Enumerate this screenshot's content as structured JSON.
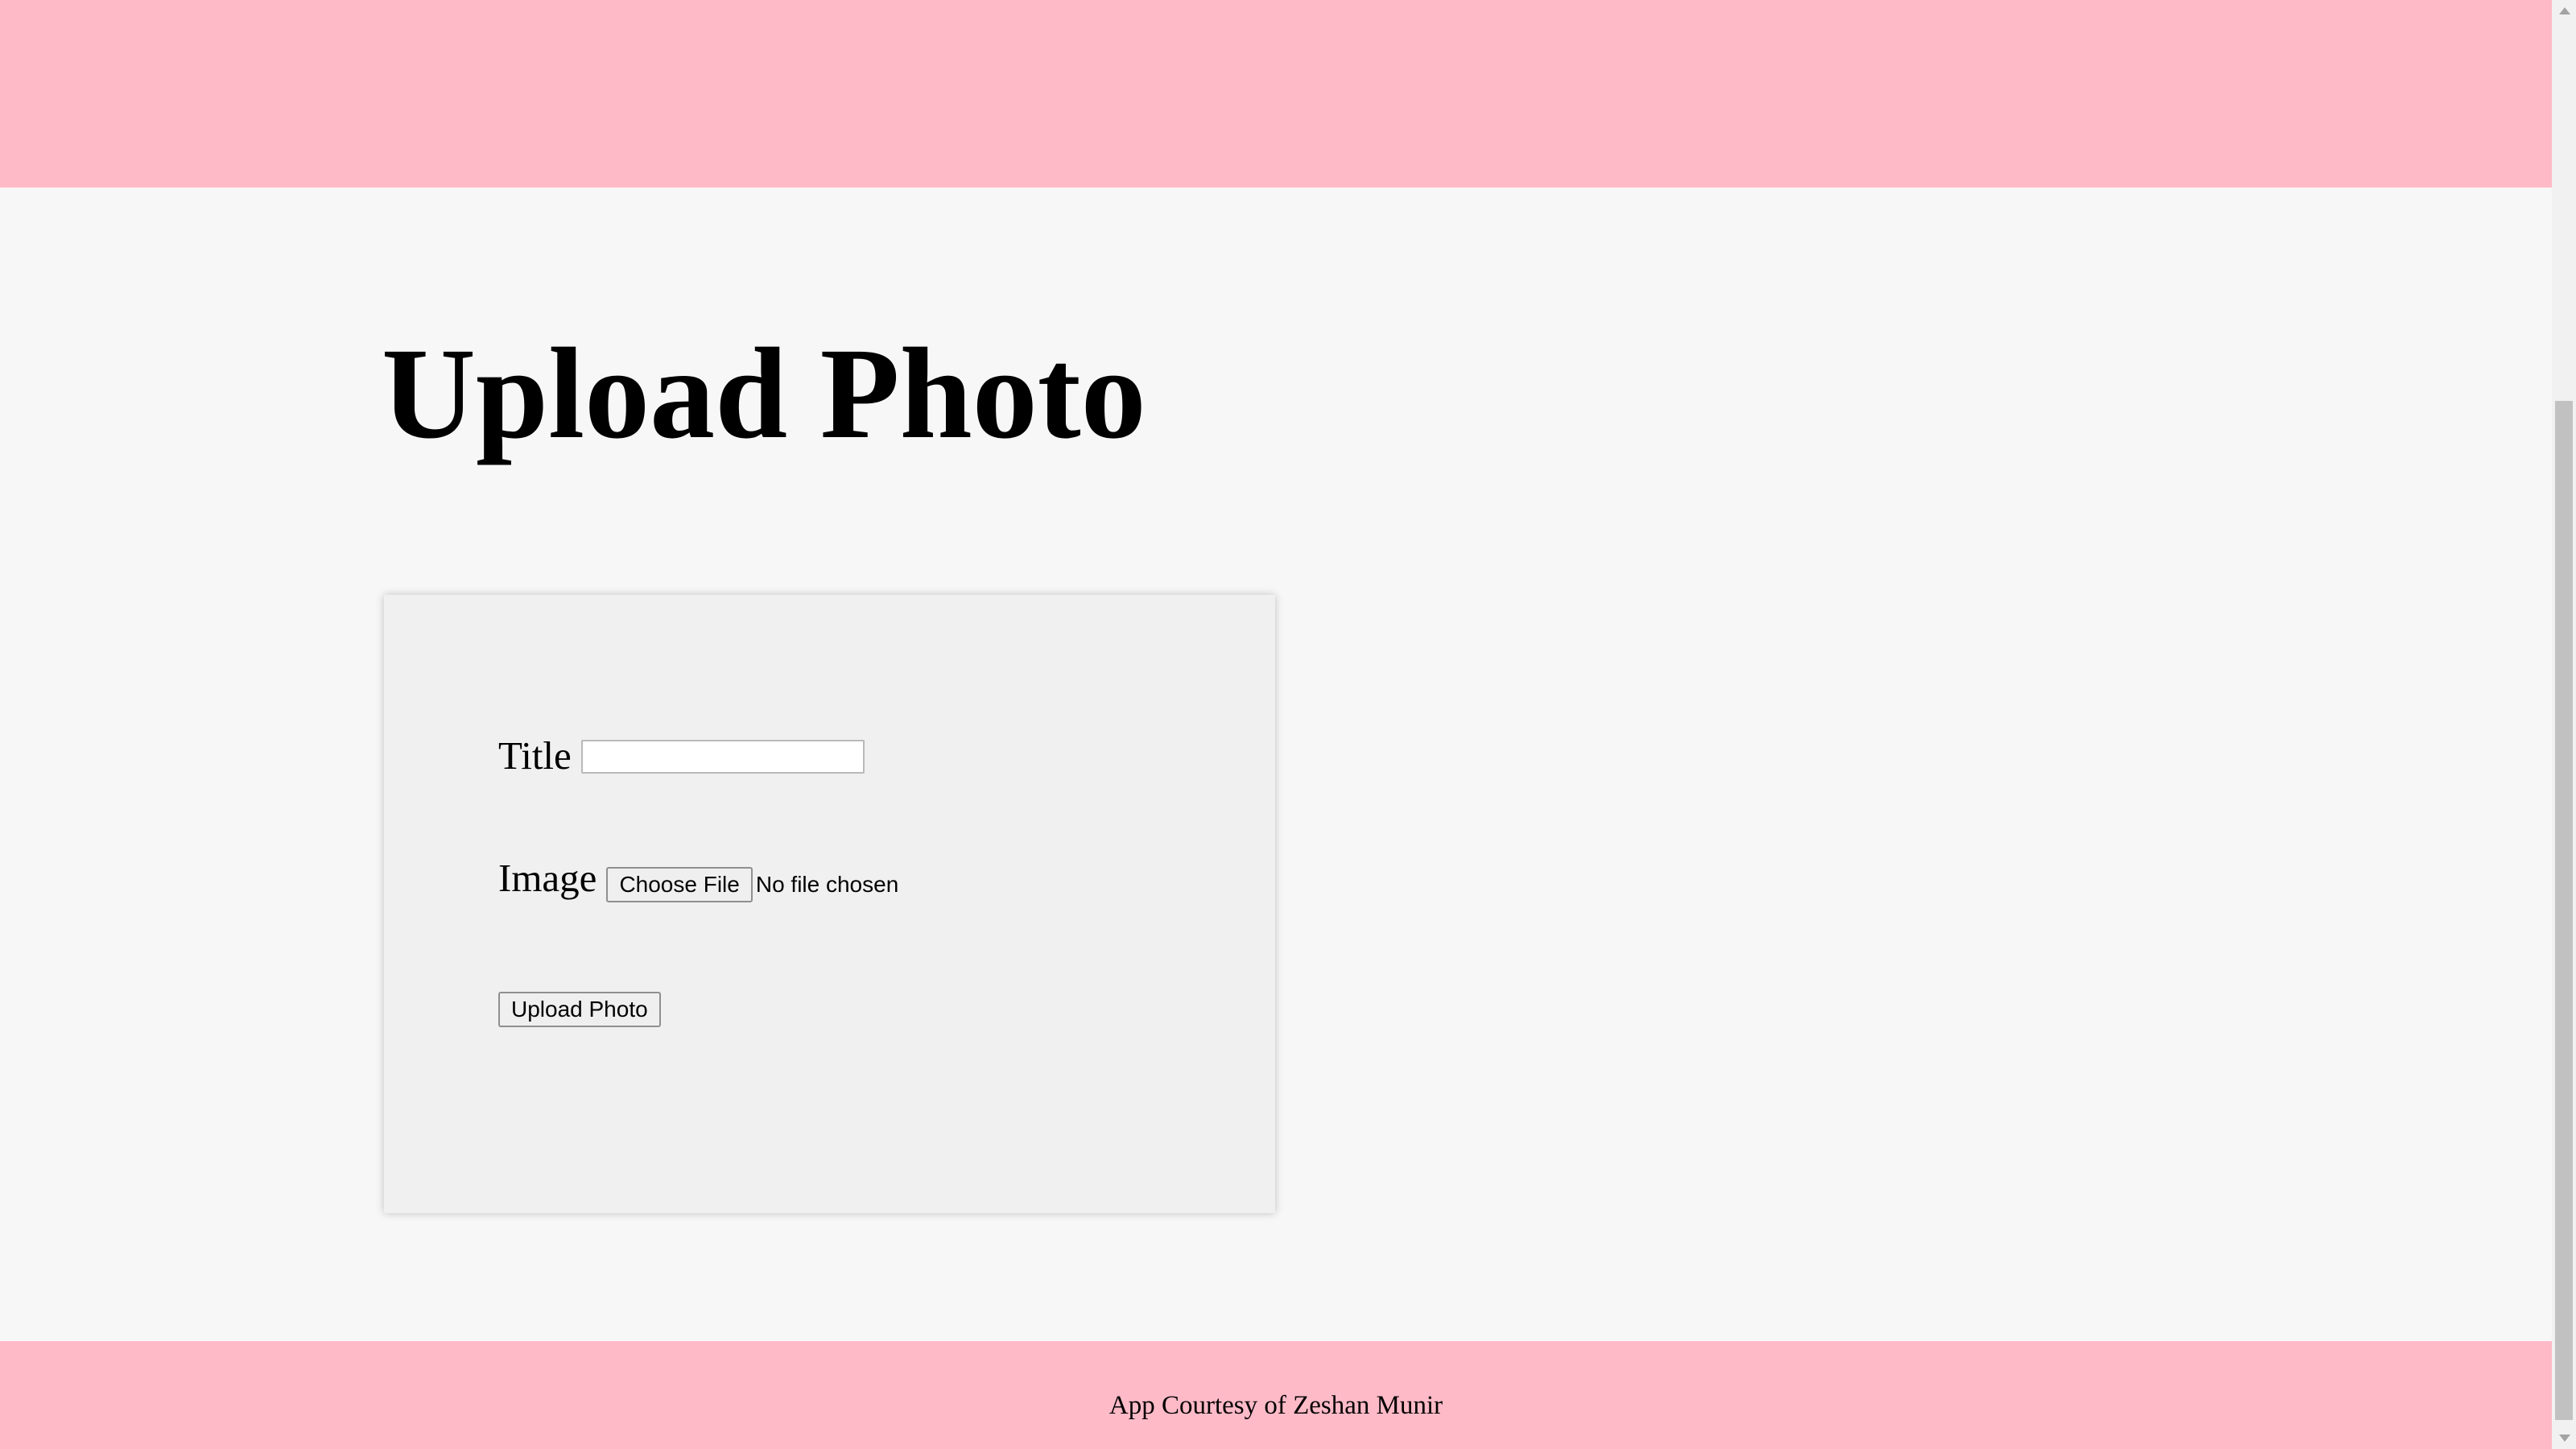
{
  "colors": {
    "banner": "#ffbac7",
    "page_background": "#f7f7f7",
    "card_background": "#f0f0f0"
  },
  "header": {
    "title": "Upload Photo"
  },
  "form": {
    "title_label": "Title",
    "title_value": "",
    "image_label": "Image",
    "choose_file_label": "Choose File",
    "file_status": "No file chosen",
    "submit_label": "Upload Photo"
  },
  "footer": {
    "credit": "App Courtesy of Zeshan Munir"
  },
  "icons": {
    "scroll_up": "triangle-up-icon",
    "scroll_down": "triangle-down-icon"
  }
}
